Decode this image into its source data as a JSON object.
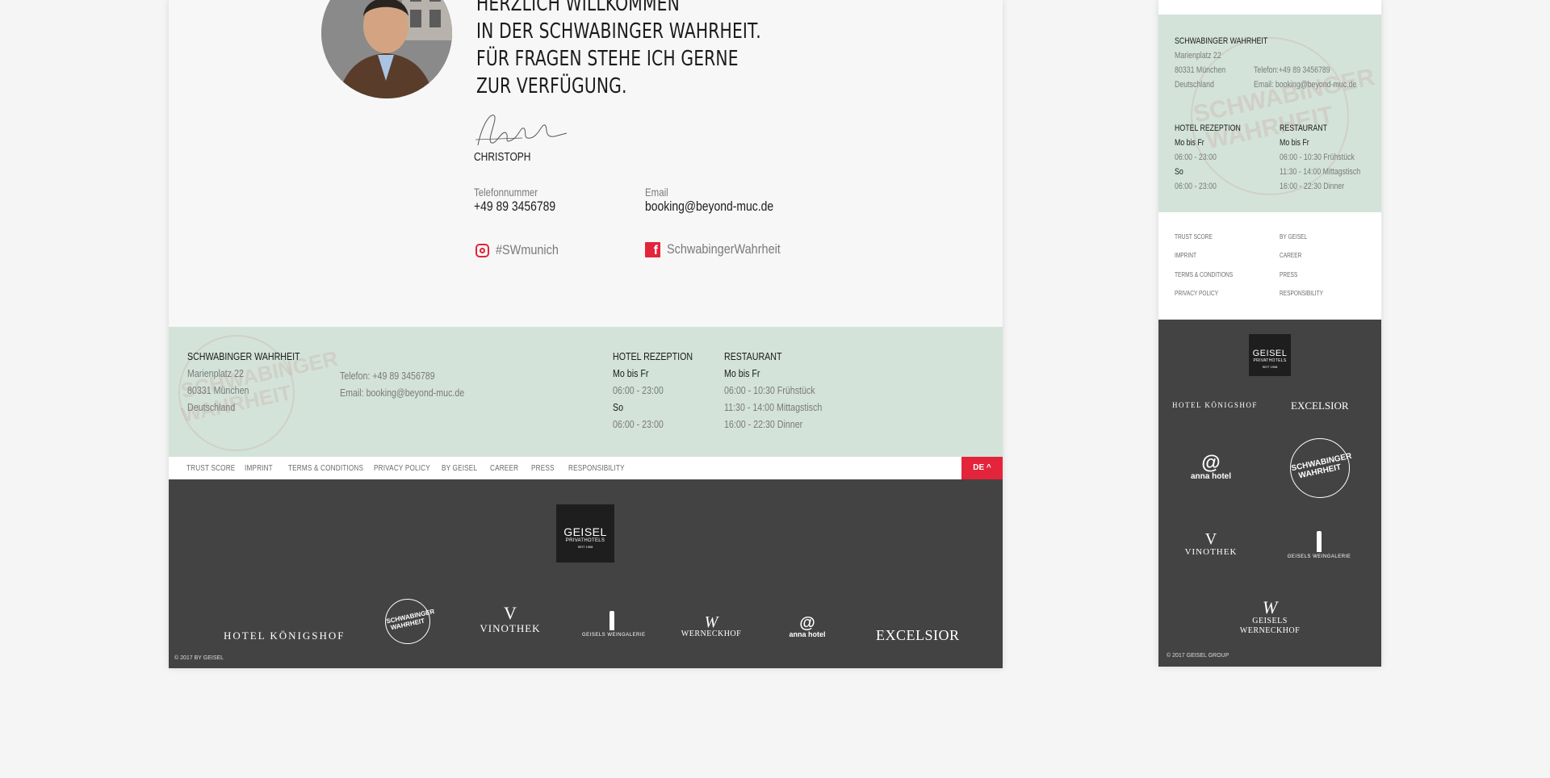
{
  "intro": {
    "headline": [
      "HERZLICH WILLKOMMEN",
      "IN DER SCHWABINGER WAHRHEIT.",
      "FÜR FRAGEN STEHE ICH GERNE",
      "ZUR VERFÜGUNG."
    ],
    "signature_name": "CHRISTOPH",
    "phone_label": "Telefonnummer",
    "phone_value": "+49 89 3456789",
    "email_label": "Email",
    "email_value": "booking@beyond-muc.de",
    "instagram": "#SWmunich",
    "facebook": "SchwabingerWahrheit"
  },
  "info": {
    "name": "SCHWABINGER WAHRHEIT",
    "street": "Marienplatz 22",
    "city": "80331 München",
    "country": "Deutschland",
    "phone": "Telefon: +49 89 3456789",
    "email": "Email: booking@beyond-muc.de",
    "hotel": {
      "title": "HOTEL REZEPTION",
      "day1": "Mo bis Fr",
      "time1": "06:00 - 23:00",
      "day2": "So",
      "time2": "06:00 - 23:00"
    },
    "restaurant": {
      "title": "RESTAURANT",
      "day": "Mo bis Fr",
      "slot1": "06:00 - 10:30 Frühstück",
      "slot2": "11:30 - 14:00 Mittagstisch",
      "slot3": "16:00 - 22:30 Dinner"
    },
    "stamp_text": [
      "SCHWABINGER",
      "WAHRHEIT"
    ]
  },
  "nav": {
    "links": [
      "TRUST SCORE",
      "IMPRINT",
      "TERMS & CONDITIONS",
      "PRIVACY POLICY",
      "BY GEISEL",
      "CAREER",
      "PRESS",
      "RESPONSIBILITY"
    ],
    "lang": "DE ^"
  },
  "brands": {
    "geisel": [
      "GEISEL",
      "PRIVATHOTELS",
      "SEIT 1908"
    ],
    "hotel_koenigshof": "HOTEL KÖNIGSHOF",
    "schwabinger": [
      "SCHWABINGER",
      "WAHRHEIT"
    ],
    "vinothek": "VINOTHEK",
    "weingalerie": "GEISELS WEINGALERIE",
    "werneckhof": "WERNECKHOF",
    "werneckhof_mobile": [
      "GEISELS",
      "WERNECKHOF"
    ],
    "anna": "anna hotel",
    "excelsior": "EXCELSIOR"
  },
  "footer": {
    "copyright_desktop": "© 2017 BY GEISEL",
    "copyright_mobile": "© 2017 GEISEL GROUP"
  },
  "mobile": {
    "phone": "Telefon:+49 89 3456789",
    "email": "Email: booking@beyond-muc.de",
    "links_left": [
      "TRUST SCORE",
      "IMPRINT",
      "TERMS & CONDITIONS",
      "PRIVACY POLICY"
    ],
    "links_right": [
      "BY GEISEL",
      "CAREER",
      "PRESS",
      "RESPONSIBILITY"
    ]
  },
  "colors": {
    "accent": "#e3243b",
    "mint": "#d3e3d9",
    "dark": "#434343"
  }
}
